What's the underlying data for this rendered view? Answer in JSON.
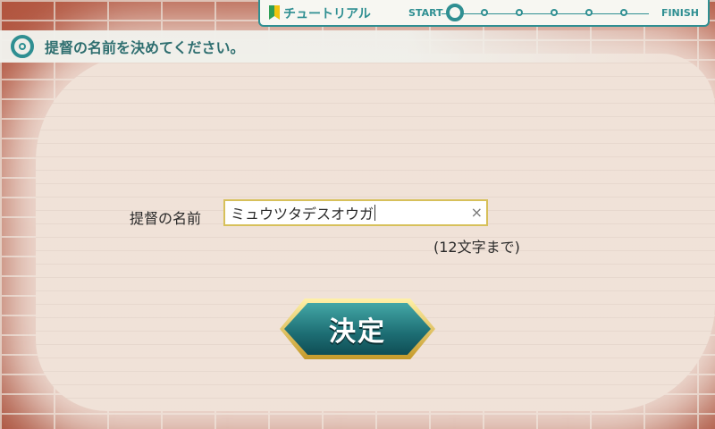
{
  "header": {
    "prompt": "提督の名前を決めてください。"
  },
  "tutorial": {
    "title": "チュートリアル",
    "start": "START",
    "finish": "FINISH"
  },
  "form": {
    "label": "提督の名前",
    "value": "ミュウツタデスオウガ",
    "clear_symbol": "×",
    "hint": "(12文字まで)"
  },
  "actions": {
    "decide_label": "決定"
  },
  "colors": {
    "teal": "#2f8f92",
    "brick": "#b2553f",
    "gold": "#d7c05a"
  }
}
